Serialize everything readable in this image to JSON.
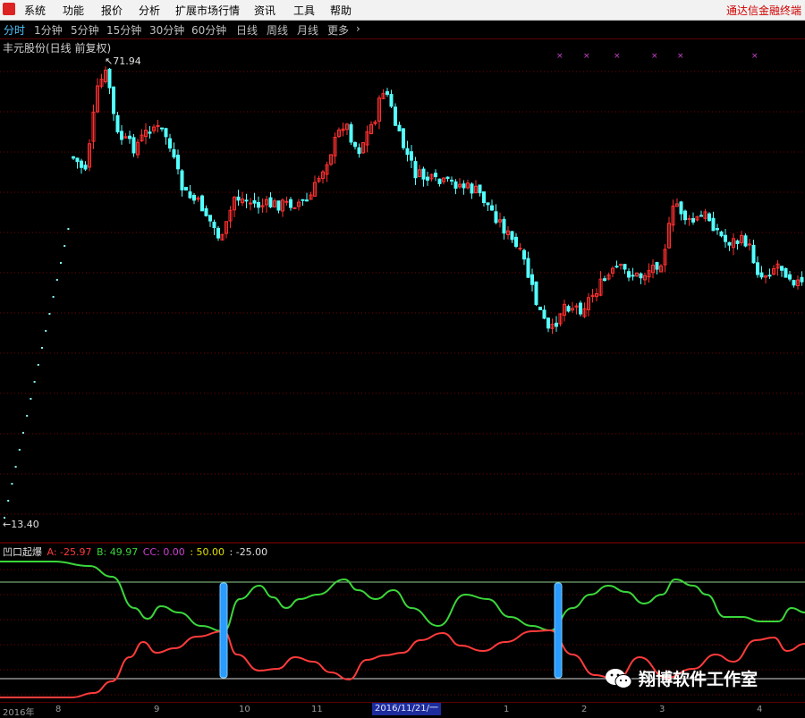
{
  "menu": {
    "items": [
      "系统",
      "功能",
      "报价",
      "分析",
      "扩展市场行情",
      "资讯",
      "工具",
      "帮助"
    ],
    "brand": "通达信金融终端"
  },
  "periods": {
    "items": [
      "分时",
      "1分钟",
      "5分钟",
      "15分钟",
      "30分钟",
      "60分钟",
      "日线",
      "周线",
      "月线",
      "更多"
    ],
    "active_index": 0,
    "more_arrow": "chevron-right-icon"
  },
  "chart": {
    "title": "丰元股份(日线 前复权)",
    "max_label": "71.94",
    "min_label": "13.40",
    "price_max": 71.94,
    "price_min": 13.4,
    "up_color": "#ff3030",
    "down_color": "#54ffff"
  },
  "indicator": {
    "name": "凹口起爆",
    "a_text": "A: -25.97",
    "b_text": "B: 49.97",
    "cc_text": "CC: 0.00",
    "level_text": ": 50.00",
    "zero_text": ": -25.00",
    "a_color": "#ff3b3b",
    "b_color": "#3bd63b",
    "cc_color": "#d040d0"
  },
  "watermark": {
    "text": "翔博软件工作室",
    "icon": "wechat-icon"
  },
  "x_axis": {
    "labels": [
      "2016年",
      "8",
      "9",
      "10",
      "11",
      "1",
      "2",
      "3",
      "4"
    ],
    "cursor": "2016/11/21/一"
  }
}
